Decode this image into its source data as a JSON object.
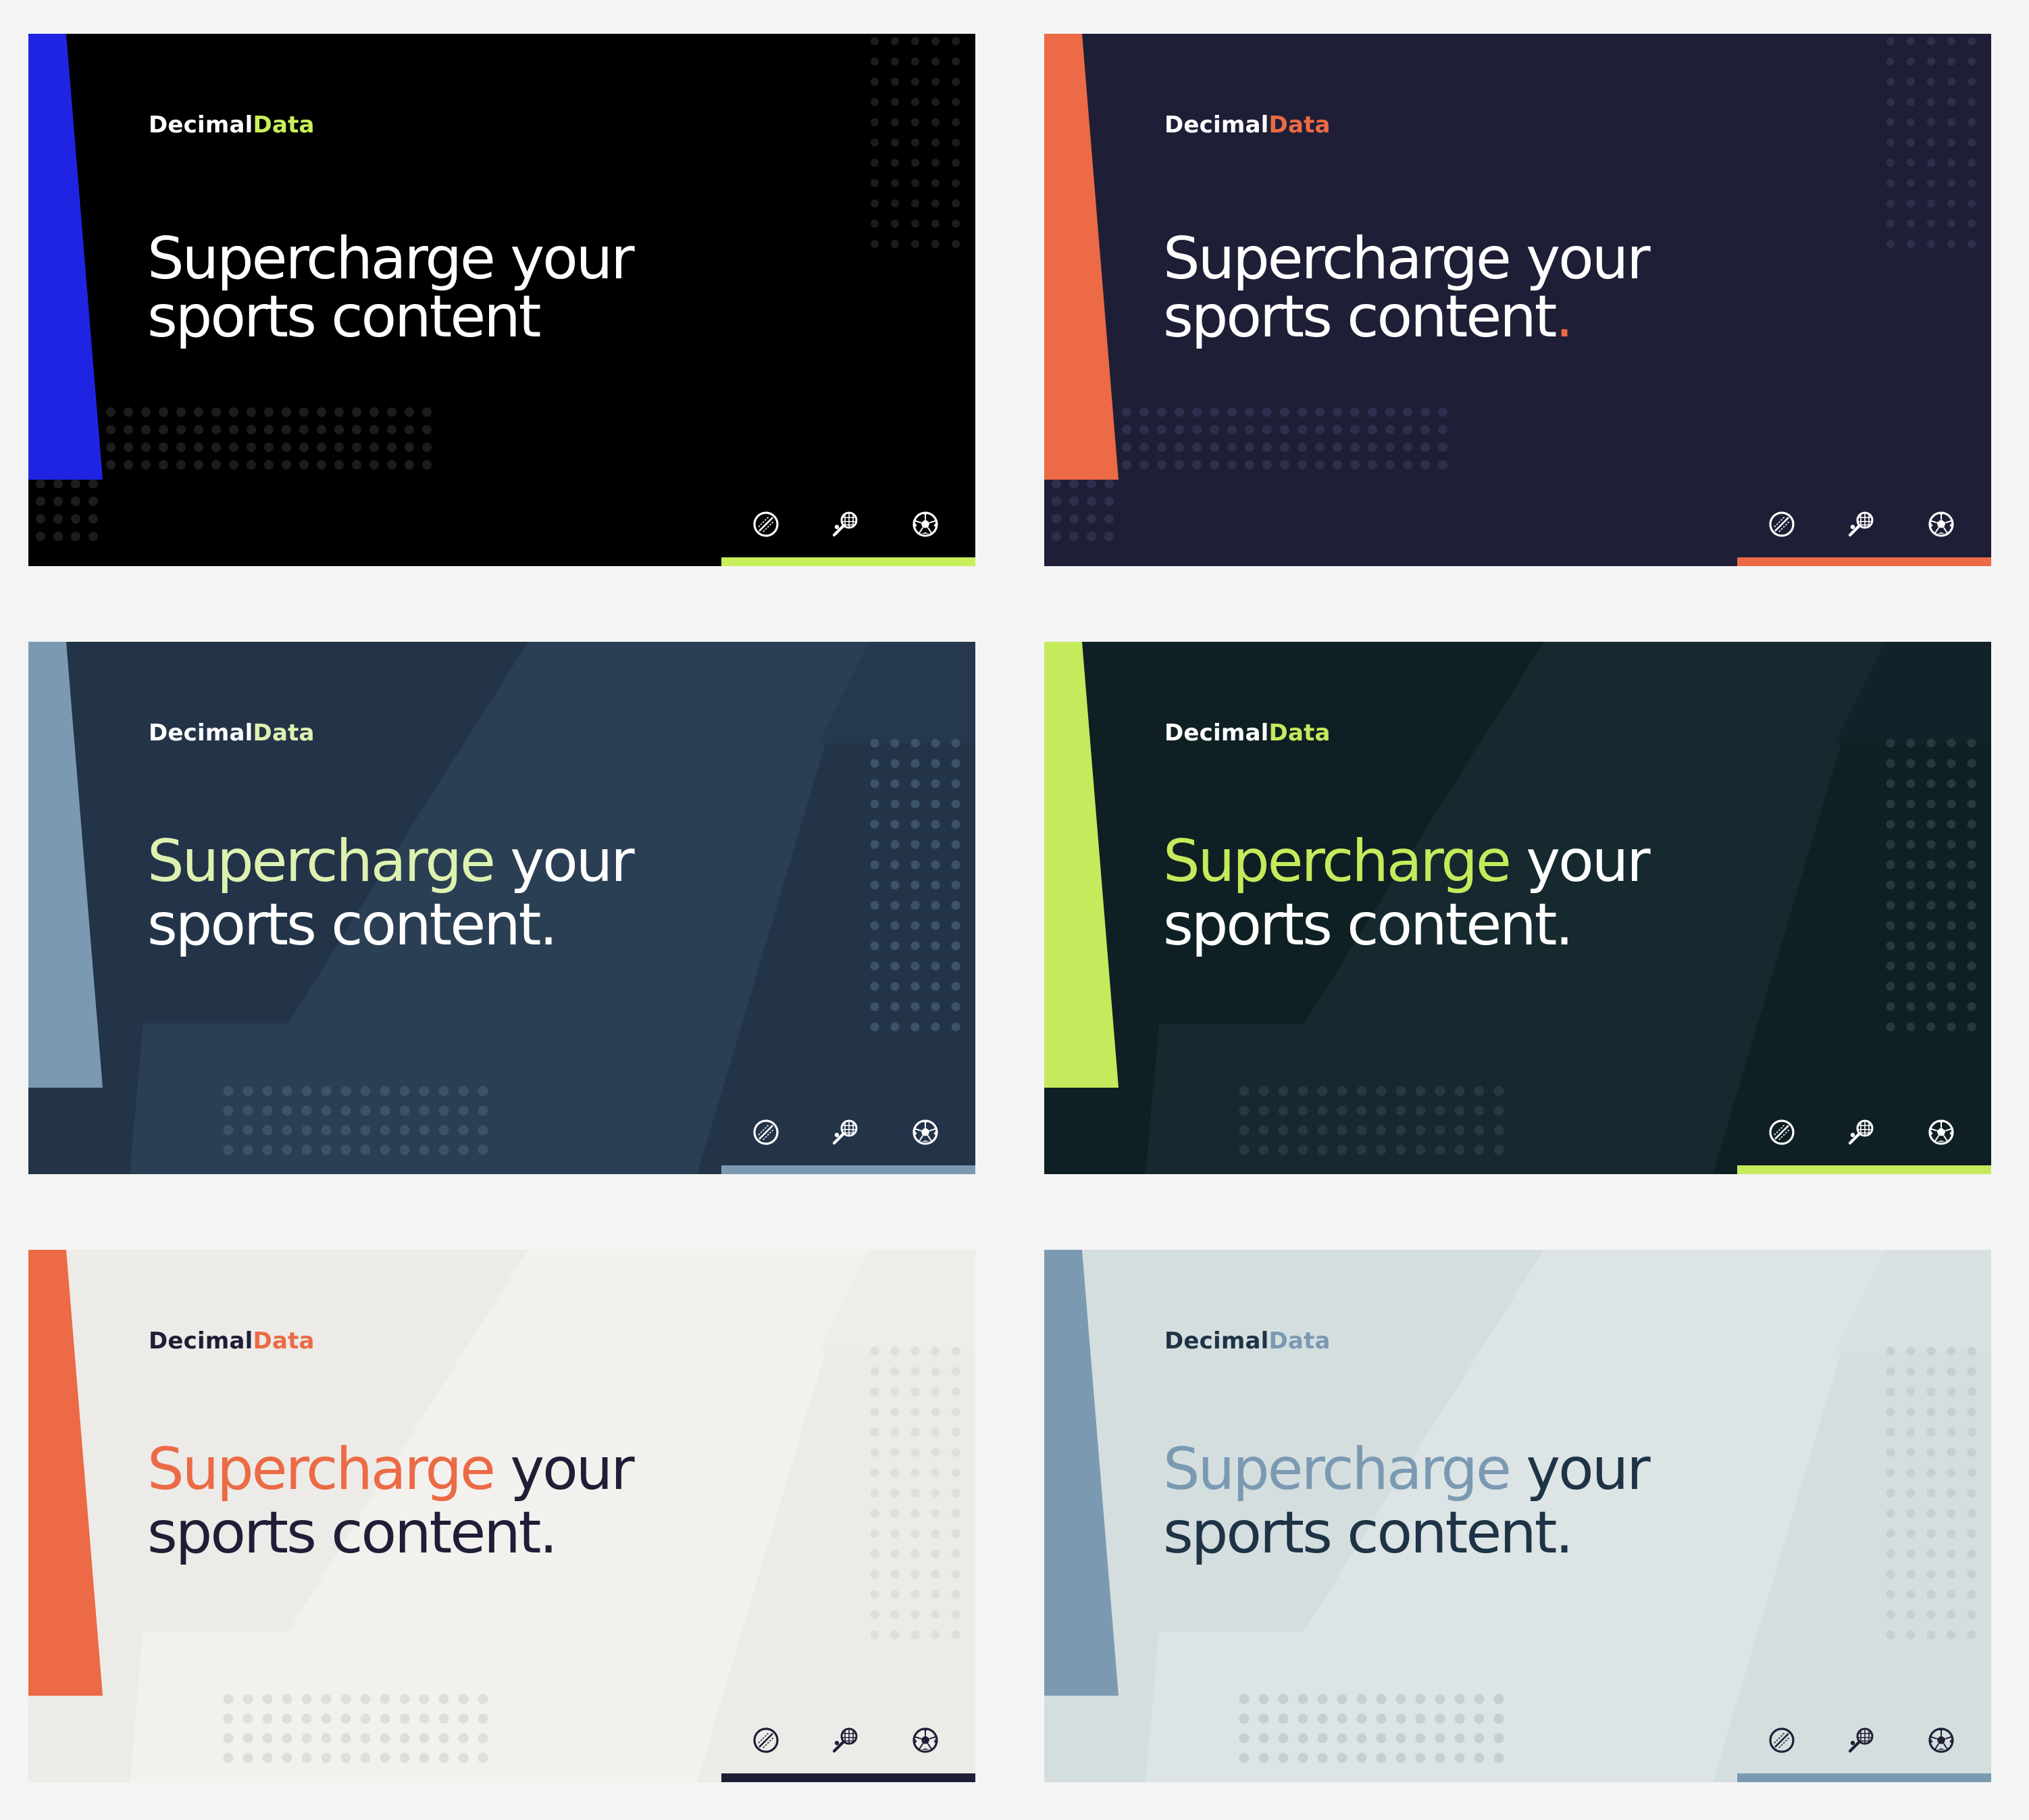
{
  "cards": [
    {
      "brand": {
        "part1": "Decimal",
        "part2": "Data"
      },
      "headline": {
        "accent": "",
        "rest1": "Supercharge your",
        "line2": "sports content",
        "period": ""
      },
      "colors": {
        "bg": "#000000",
        "bg2": "#000000",
        "wedge": "#1f24e3",
        "text": "#ffffff",
        "brand1": "#ffffff",
        "brand2": "#c8f05a",
        "headlineAccent": "#ffffff",
        "period": "#ffffff",
        "bar": "#c8f05a",
        "dots": "#1c1c1c",
        "icons": "#ffffff"
      }
    },
    {
      "brand": {
        "part1": "Decimal",
        "part2": "Data"
      },
      "headline": {
        "accent": "",
        "rest1": "Supercharge your",
        "line2": "sports content",
        "period": "."
      },
      "colors": {
        "bg": "#1e1f36",
        "bg2": "#1e1f36",
        "wedge": "#ec6a45",
        "text": "#ffffff",
        "brand1": "#ffffff",
        "brand2": "#ec6a45",
        "headlineAccent": "#ffffff",
        "period": "#ec6a45",
        "bar": "#ec6a45",
        "dots": "#2d2f4c",
        "icons": "#ffffff"
      }
    },
    {
      "brand": {
        "part1": "Decimal",
        "part2": "Data"
      },
      "headline": {
        "accent": "Supercharge",
        "rest1": " your",
        "line2": "sports content",
        "period": "."
      },
      "colors": {
        "bg": "#233449",
        "bg2": "#2b3f54",
        "wedge": "#7b9ab2",
        "text": "#ffffff",
        "brand1": "#ffffff",
        "brand2": "#def2b0",
        "headlineAccent": "#def2b0",
        "period": "#ffffff",
        "bar": "#7b9ab2",
        "dots": "#3c5268",
        "icons": "#ffffff"
      }
    },
    {
      "brand": {
        "part1": "Decimal",
        "part2": "Data"
      },
      "headline": {
        "accent": "Supercharge",
        "rest1": " your",
        "line2": "sports content",
        "period": "."
      },
      "colors": {
        "bg": "#0f2024",
        "bg2": "#15292e",
        "wedge": "#c5ea5c",
        "text": "#ffffff",
        "brand1": "#ffffff",
        "brand2": "#c5ea5c",
        "headlineAccent": "#c5ea5c",
        "period": "#ffffff",
        "bar": "#c5ea5c",
        "dots": "#243a3f",
        "icons": "#ffffff"
      }
    },
    {
      "brand": {
        "part1": "Decimal",
        "part2": "Data"
      },
      "headline": {
        "accent": "Supercharge",
        "rest1": " your",
        "line2": "sports content",
        "period": "."
      },
      "colors": {
        "bg": "#ecebe8",
        "bg2": "#f2f1ee",
        "wedge": "#ec6a45",
        "text": "#1e1f36",
        "brand1": "#1e1f36",
        "brand2": "#ec6a45",
        "headlineAccent": "#ec6a45",
        "period": "#1e1f36",
        "bar": "#1e1f36",
        "dots": "#dededb",
        "icons": "#1e1f36"
      }
    },
    {
      "brand": {
        "part1": "Decimal",
        "part2": "Data"
      },
      "headline": {
        "accent": "Supercharge",
        "rest1": " your",
        "line2": "sports content",
        "period": "."
      },
      "colors": {
        "bg": "#d5dedf",
        "bg2": "#dde4e5",
        "wedge": "#7b9ab2",
        "text": "#1f3346",
        "brand1": "#1f3346",
        "brand2": "#7b9ab2",
        "headlineAccent": "#7b9ab2",
        "period": "#1f3346",
        "bar": "#7b9ab2",
        "dots": "#c5d0d3",
        "icons": "#1e1f36"
      }
    }
  ],
  "icons": [
    "cricket-ball-icon",
    "tennis-racket-icon",
    "soccer-ball-icon"
  ]
}
